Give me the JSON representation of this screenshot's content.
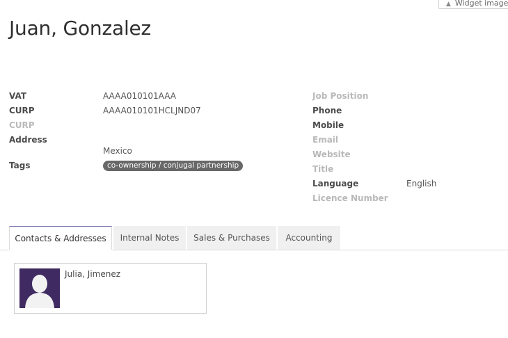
{
  "widget_button": {
    "label": "Widget image"
  },
  "partner": {
    "name": "Juan, Gonzalez"
  },
  "left_fields": [
    {
      "label": "VAT",
      "value": "AAAA010101AAA",
      "muted": false
    },
    {
      "label": "CURP",
      "value": "AAAA010101HCLJND07",
      "muted": false
    },
    {
      "label": "CURP",
      "value": "",
      "muted": true
    },
    {
      "label": "Address",
      "value": "",
      "muted": false
    },
    {
      "label": "",
      "value": "Mexico",
      "muted": false
    },
    {
      "label": "Tags",
      "value": "",
      "muted": false
    }
  ],
  "tags": [
    "co-ownership / conjugal partnership"
  ],
  "right_fields": [
    {
      "label": "Job Position",
      "value": "",
      "muted": true
    },
    {
      "label": "Phone",
      "value": "",
      "muted": false
    },
    {
      "label": "Mobile",
      "value": "",
      "muted": false
    },
    {
      "label": "Email",
      "value": "",
      "muted": true
    },
    {
      "label": "Website",
      "value": "",
      "muted": true
    },
    {
      "label": "Title",
      "value": "",
      "muted": true
    },
    {
      "label": "Language",
      "value": "English",
      "muted": false
    },
    {
      "label": "Licence Number",
      "value": "",
      "muted": true
    }
  ],
  "tabs": [
    {
      "label": "Contacts & Addresses",
      "active": true
    },
    {
      "label": "Internal Notes",
      "active": false
    },
    {
      "label": "Sales & Purchases",
      "active": false
    },
    {
      "label": "Accounting",
      "active": false
    }
  ],
  "contacts": [
    {
      "name": "Julia, Jimenez",
      "avatar_icon": "person-silhouette-icon"
    }
  ],
  "colors": {
    "tag_bg": "#686868",
    "active_tab_accent": "#7c7bad",
    "avatar_bg": "#3f2b62"
  }
}
